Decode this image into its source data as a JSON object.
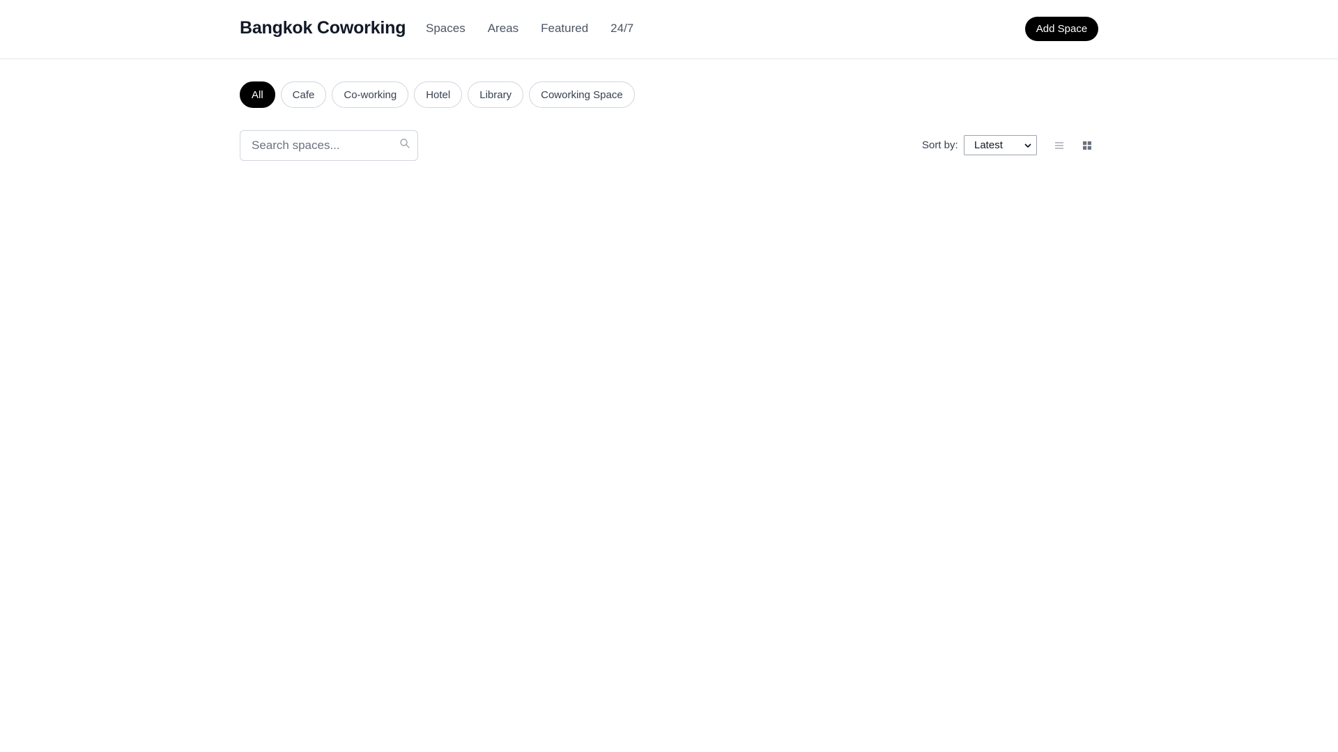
{
  "header": {
    "brand": "Bangkok Coworking",
    "nav": [
      {
        "label": "Spaces"
      },
      {
        "label": "Areas"
      },
      {
        "label": "Featured"
      },
      {
        "label": "24/7"
      }
    ],
    "add_button": "Add Space"
  },
  "filters": [
    {
      "label": "All",
      "active": true
    },
    {
      "label": "Cafe",
      "active": false
    },
    {
      "label": "Co-working",
      "active": false
    },
    {
      "label": "Hotel",
      "active": false
    },
    {
      "label": "Library",
      "active": false
    },
    {
      "label": "Coworking Space",
      "active": false
    }
  ],
  "search": {
    "placeholder": "Search spaces...",
    "value": "",
    "icon": "search-icon"
  },
  "sort": {
    "label": "Sort by:",
    "selected": "Latest"
  },
  "view_toggle": {
    "list_icon": "list-icon",
    "grid_icon": "grid-icon"
  },
  "colors": {
    "accent": "#000000",
    "border": "#d1d5db",
    "muted_text": "#4b5563"
  }
}
